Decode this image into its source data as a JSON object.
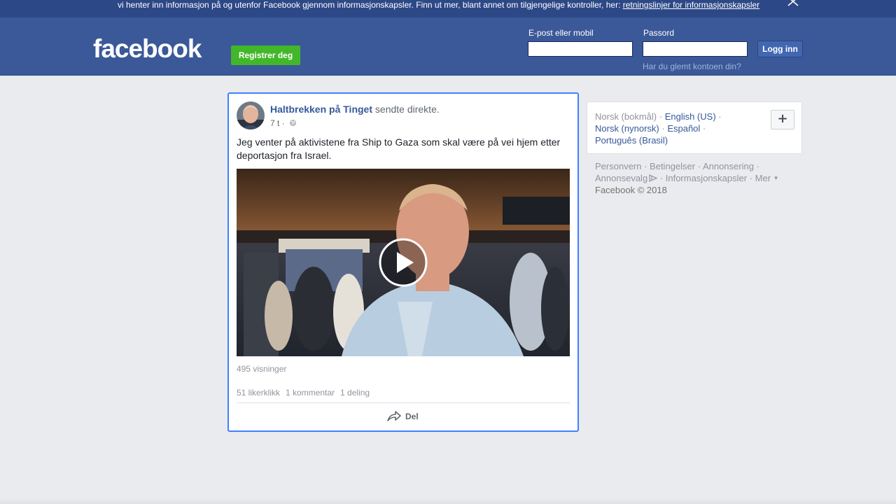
{
  "cookie_banner": {
    "text": "vi henter inn informasjon på og utenfor Facebook gjennom informasjonskapsler. Finn ut mer, blant annet om tilgjengelige kontroller, her: ",
    "link": "retningslinjer for informasjonskapsler"
  },
  "header": {
    "logo_text": "facebook",
    "register_label": "Registrer deg",
    "email_label": "E-post eller mobil",
    "email_value": "",
    "password_label": "Passord",
    "password_value": "",
    "login_label": "Logg inn",
    "forgot_link": "Har du glemt kontoen din?"
  },
  "post": {
    "author": "Haltbrekken på Tinget",
    "action": " sendte direkte.",
    "time": "7 t",
    "meta_separator": " · ",
    "text": "Jeg venter på aktivistene fra Ship to Gaza som skal være på vei hjem etter deportasjon fra Israel.",
    "views": "495 visninger",
    "likes": "51 likerklikk",
    "comments": "1 kommentar",
    "shares": "1 deling",
    "share_label": "Del"
  },
  "languages": {
    "current": "Norsk (bokmål)",
    "links": [
      "English (US)",
      "Norsk (nynorsk)",
      "Español",
      "Português (Brasil)"
    ],
    "separator": " · ",
    "more_label": "+"
  },
  "footer": {
    "links": [
      "Personvern",
      "Betingelser",
      "Annonsering",
      "Annonsevalg",
      "Informasjonskapsler",
      "Mer"
    ],
    "separator": " · ",
    "copyright": "Facebook © 2018"
  },
  "colors": {
    "brand_blue": "#3b5998",
    "register_green": "#42b72a",
    "link_blue": "#365899",
    "focus_blue": "#4080ff"
  }
}
